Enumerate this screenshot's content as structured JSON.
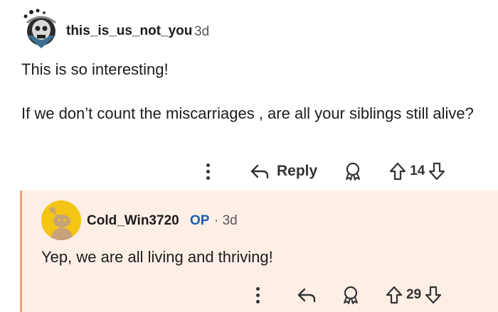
{
  "parent_comment": {
    "username": "this_is_us_not_you",
    "age": "3d",
    "paragraph_1": "This is so interesting!",
    "paragraph_2": "If we don’t count the miscarriages , are all your siblings still alive?",
    "reply_label": "Reply",
    "score": "14",
    "avatar_icon": "skull-helmet-avatar"
  },
  "reply_comment": {
    "username": "Cold_Win3720",
    "op_badge": "OP",
    "age": "· 3d",
    "text": "Yep, we are all living and thriving!",
    "score": "29",
    "avatar_icon": "snoo-avatar"
  },
  "colors": {
    "reply_background": "#fdefe6",
    "reply_border": "#f0a27c",
    "op_badge": "#1a5fb4",
    "avatar_yellow": "#f4c515"
  }
}
